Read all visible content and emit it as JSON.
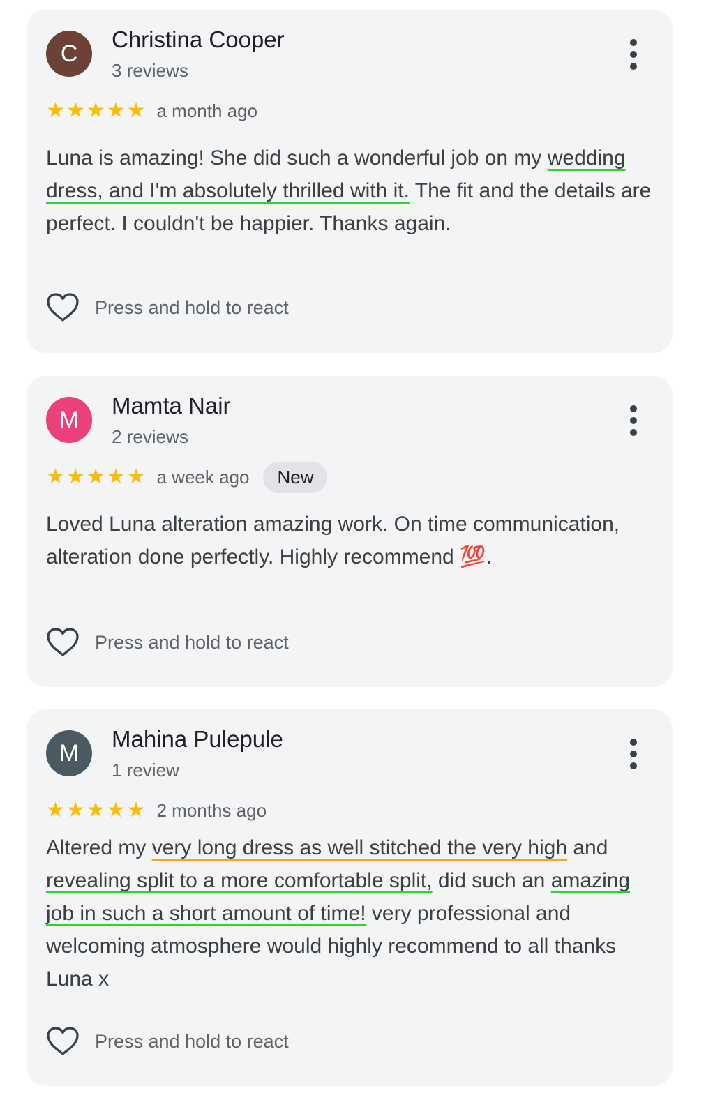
{
  "reviews": [
    {
      "initial": "C",
      "avatar_color": "#6d4136",
      "name": "Christina Cooper",
      "review_count": "3 reviews",
      "stars": "★★★★★",
      "rating": 5,
      "time": "a month ago",
      "text": [
        "Luna is amazing! She did such a wonderful job on my ",
        "wedding dress, and I'm absolutely thrilled with it.",
        " The fit and the details are perfect. I couldn't be happier. Thanks again."
      ],
      "react_label": "Press and hold to react"
    },
    {
      "initial": "M",
      "avatar_color": "#ec407a",
      "name": "Mamta Nair",
      "review_count": "2 reviews",
      "stars": "★★★★★",
      "rating": 5,
      "time": "a week ago",
      "badge": "New",
      "text": "Loved Luna alteration amazing work. On time communication, alteration done perfectly. Highly recommend 💯.",
      "react_label": "Press and hold to react"
    },
    {
      "initial": "M",
      "avatar_color": "#4a5a63",
      "name": "Mahina Pulepule",
      "review_count": "1 review",
      "stars": "★★★★★",
      "rating": 5,
      "time": "2 months ago",
      "text": [
        "Altered my ",
        "very long dress as well stitched the very high",
        " and ",
        "revealing split to a more comfortable split,",
        " did such an ",
        "amazing job in such a short amount of time!",
        " very professional and welcoming atmosphere would highly recommend to all thanks Luna x"
      ],
      "react_label": "Press and hold to react"
    }
  ],
  "colors": {
    "card_background": "#f3f4f6",
    "star": "#fbbc04",
    "highlight_green": "#2ed52e",
    "highlight_orange": "#f5a623"
  }
}
